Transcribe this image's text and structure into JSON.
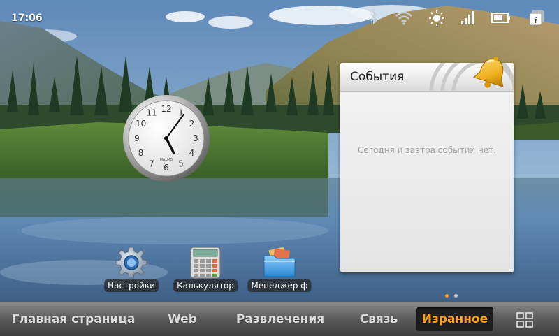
{
  "status_bar": {
    "time": "17:06",
    "icons": [
      "bluetooth-icon",
      "wifi-icon",
      "brightness-icon",
      "signal-icon",
      "battery-icon",
      "info-icon"
    ]
  },
  "clock_widget": {
    "brand": "MALMO",
    "numbers": [
      "12",
      "1",
      "2",
      "3",
      "4",
      "5",
      "6",
      "7",
      "8",
      "9",
      "10",
      "11"
    ],
    "time": "17:06"
  },
  "events_widget": {
    "title": "События",
    "empty_message": "Сегодня и завтра событий нет."
  },
  "apps": [
    {
      "label": "Настройки",
      "icon": "gear-icon"
    },
    {
      "label": "Калькулятор",
      "icon": "calculator-icon"
    },
    {
      "label": "Менеджер ф",
      "icon": "folder-icon"
    }
  ],
  "page_indicator": {
    "count": 2,
    "active": 0
  },
  "tabs": [
    {
      "label": "Главная страница",
      "active": false
    },
    {
      "label": "Web",
      "active": false
    },
    {
      "label": "Развлечения",
      "active": false
    },
    {
      "label": "Связь",
      "active": false
    },
    {
      "label": "Изранное",
      "active": true
    }
  ],
  "colors": {
    "active_tab": "#ffa21a",
    "label_bg": "#282828",
    "widget_bg": "#ececec"
  }
}
